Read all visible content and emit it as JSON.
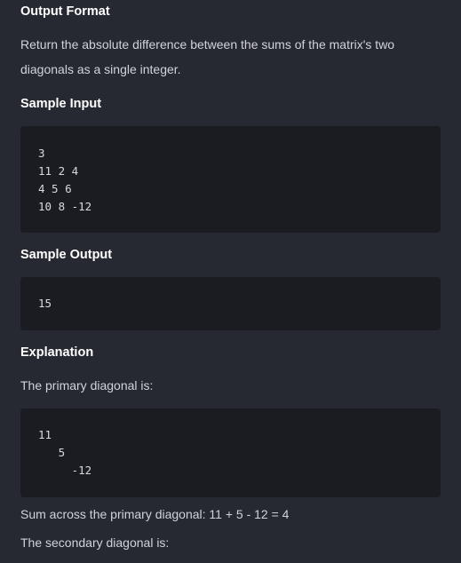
{
  "output_format": {
    "heading": "Output Format",
    "text": "Return the absolute difference between the sums of the matrix's two diagonals as a single integer."
  },
  "sample_input": {
    "heading": "Sample Input",
    "lines": [
      "3",
      "11 2 4",
      "4 5 6",
      "10 8 -12"
    ]
  },
  "sample_output": {
    "heading": "Sample Output",
    "lines": [
      "15"
    ]
  },
  "explanation": {
    "heading": "Explanation",
    "primary_intro": "The primary diagonal is:",
    "primary_lines": [
      "11",
      "   5",
      "     -12"
    ],
    "primary_sum": "Sum across the primary diagonal: 11 + 5 - 12 = 4",
    "secondary_intro": "The secondary diagonal is:"
  }
}
